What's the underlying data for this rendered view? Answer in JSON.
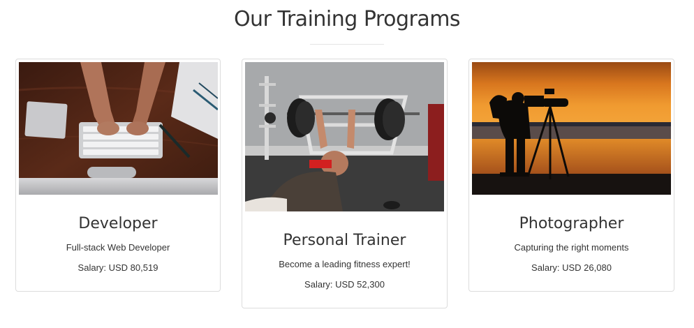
{
  "section": {
    "title": "Our Training Programs"
  },
  "programs": [
    {
      "title": "Developer",
      "subtitle": "Full-stack Web Developer",
      "salary": "Salary: USD 80,519",
      "image": "developer-keyboard-desk-photo"
    },
    {
      "title": "Personal Trainer",
      "subtitle": "Become a leading fitness expert!",
      "salary": "Salary: USD 52,300",
      "image": "bench-press-gym-photo"
    },
    {
      "title": "Photographer",
      "subtitle": "Capturing the right moments",
      "salary": "Salary: USD 26,080",
      "image": "sunset-photographer-silhouette-photo"
    }
  ],
  "colors": {
    "text": "#333333",
    "card_border": "#dcdcdc",
    "divider": "#e5e5e5",
    "background": "#ffffff"
  }
}
